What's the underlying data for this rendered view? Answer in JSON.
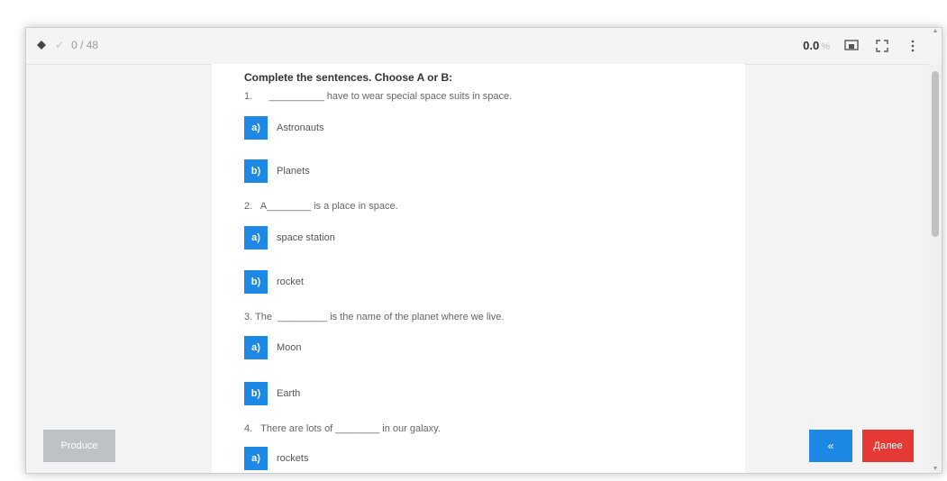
{
  "topbar": {
    "progress": "0 / 48",
    "score": "0.0",
    "score_unit": "%"
  },
  "instruction": "Complete the sentences. Choose A or B:",
  "questions": [
    {
      "text": "1.      __________ have to wear special space suits in space.",
      "options": [
        {
          "letter": "a)",
          "label": "Astronauts"
        },
        {
          "letter": "b)",
          "label": "Planets"
        }
      ]
    },
    {
      "text": "2.   A________ is a place in space.",
      "options": [
        {
          "letter": "a)",
          "label": "space station"
        },
        {
          "letter": "b)",
          "label": "rocket"
        }
      ]
    },
    {
      "text": "3. The  _________ is the name of the planet where we live.",
      "options": [
        {
          "letter": "a)",
          "label": "Moon"
        },
        {
          "letter": "b)",
          "label": "Earth"
        }
      ]
    },
    {
      "text": "4.   There are lots of ________ in our galaxy.",
      "options": [
        {
          "letter": "a)",
          "label": "rockets"
        }
      ]
    }
  ],
  "buttons": {
    "left": "Produce",
    "middle": "«",
    "right": "Далее"
  },
  "colors": {
    "accent": "#1e88e5",
    "danger": "#e53935",
    "disabled": "#bcc2c6"
  },
  "icons": [
    "pin-icon",
    "check-icon",
    "screen-icon",
    "fullscreen-icon",
    "more-vertical-icon"
  ]
}
